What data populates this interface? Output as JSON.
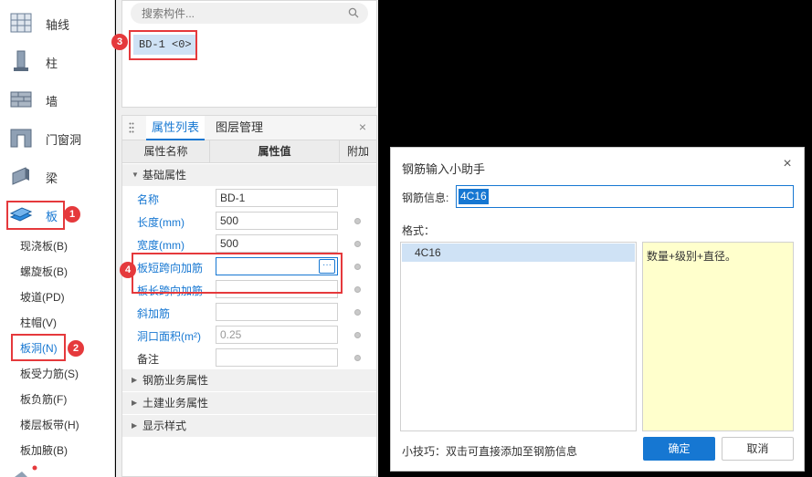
{
  "nav": {
    "items": [
      {
        "label": "轴线",
        "icon": "axis-grid-icon"
      },
      {
        "label": "柱",
        "icon": "column-icon"
      },
      {
        "label": "墙",
        "icon": "wall-icon"
      },
      {
        "label": "门窗洞",
        "icon": "door-window-icon"
      },
      {
        "label": "梁",
        "icon": "beam-icon"
      },
      {
        "label": "板",
        "icon": "slab-icon"
      }
    ],
    "sub_items": [
      "现浇板(B)",
      "螺旋板(B)",
      "坡道(PD)",
      "柱帽(V)",
      "板洞(N)",
      "板受力筋(S)",
      "板负筋(F)",
      "楼层板带(H)",
      "板加腋(B)"
    ],
    "active_sub": "板洞(N)"
  },
  "badges": [
    "1",
    "2",
    "3",
    "4"
  ],
  "search": {
    "placeholder": "搜索构件..."
  },
  "component": {
    "tag": "BD-1 <0>"
  },
  "props": {
    "tabs": [
      "属性列表",
      "图层管理"
    ],
    "close": "×",
    "headers": {
      "name": "属性名称",
      "value": "属性值",
      "extra": "附加"
    },
    "group_basic": "基础属性",
    "rows": [
      {
        "name": "名称",
        "value": "BD-1"
      },
      {
        "name": "长度(mm)",
        "value": "500"
      },
      {
        "name": "宽度(mm)",
        "value": "500"
      },
      {
        "name": "板短跨向加筋",
        "value": ""
      },
      {
        "name": "板长跨向加筋",
        "value": ""
      },
      {
        "name": "斜加筋",
        "value": ""
      },
      {
        "name": "洞口面积(m²)",
        "value": "0.25"
      },
      {
        "name": "备注",
        "value": ""
      }
    ],
    "ellipsis": "···",
    "groups_collapsed": [
      "钢筋业务属性",
      "土建业务属性",
      "显示样式"
    ]
  },
  "dialog": {
    "title": "钢筋输入小助手",
    "close": "×",
    "info_label": "钢筋信息:",
    "info_value": "4C16",
    "format_label": "格式：",
    "format_items": [
      "4C16"
    ],
    "format_desc": "数量+级别+直径。",
    "tip": "小技巧：双击可直接添加至钢筋信息",
    "ok": "确定",
    "cancel": "取消"
  },
  "colors": {
    "accent": "#1677d2",
    "highlight": "#e5393c",
    "desc_bg": "#ffffcc"
  }
}
